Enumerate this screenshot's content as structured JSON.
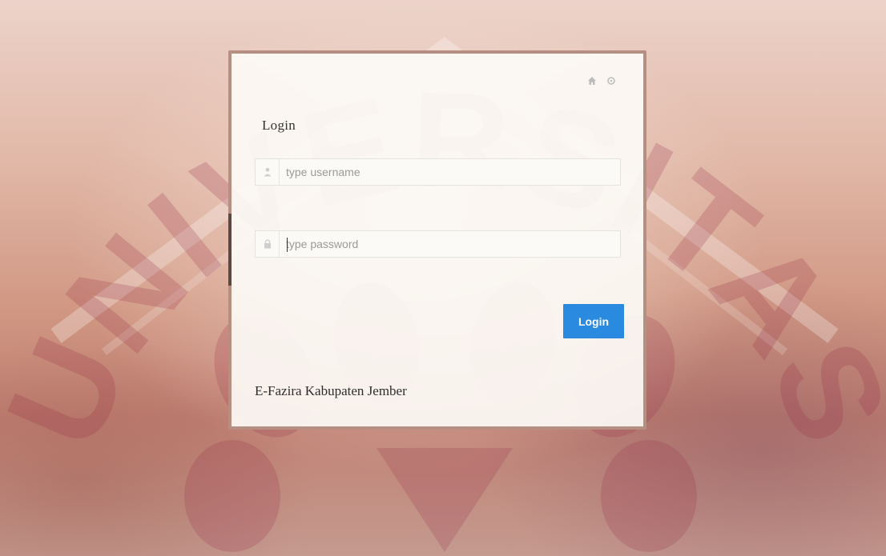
{
  "background": {
    "watermark_text": "UNIVERSITAS"
  },
  "login_card": {
    "title": "Login",
    "home_icon": "home-icon",
    "settings_icon": "gear-icon",
    "username": {
      "icon": "user-icon",
      "placeholder": "type username",
      "value": ""
    },
    "password": {
      "icon": "lock-icon",
      "placeholder": "type password",
      "value": ""
    },
    "login_button_label": "Login",
    "footer_text": "E-Fazira Kabupaten Jember"
  },
  "colors": {
    "accent": "#2a8ae0",
    "card_border": "#b48f82"
  }
}
